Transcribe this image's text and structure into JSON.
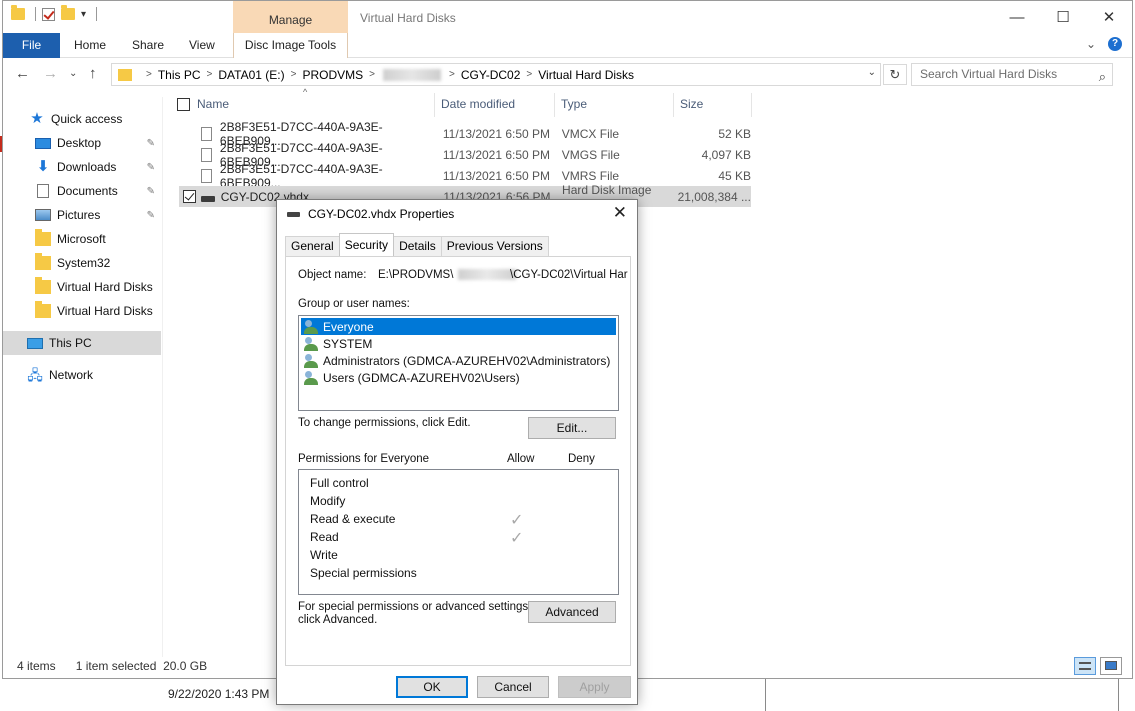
{
  "titlebar": {
    "manage_label": "Manage",
    "title": "Virtual Hard Disks",
    "minimize_glyph": "—",
    "maximize_glyph": "☐",
    "close_glyph": "✕",
    "qat_dropdown_glyph": "▾"
  },
  "ribbon": {
    "tabs": [
      {
        "label": "File"
      },
      {
        "label": "Home"
      },
      {
        "label": "Share"
      },
      {
        "label": "View"
      },
      {
        "label": "Disc Image Tools"
      }
    ],
    "collapse_glyph": "⌄",
    "help_glyph": "?"
  },
  "nav": {
    "back_glyph": "←",
    "forward_glyph": "→",
    "recent_glyph": "⌄",
    "up_glyph": "↑",
    "refresh_glyph": "↻",
    "search_placeholder": "Search Virtual Hard Disks",
    "search_glyph": "⌕",
    "dropdown_glyph": "⌄",
    "breadcrumb": {
      "sep": ">",
      "this_pc": "This PC",
      "drive": "DATA01 (E:)",
      "folder1": "PRODVMS",
      "folder3": "CGY-DC02",
      "folder4": "Virtual Hard Disks"
    }
  },
  "sidebar": {
    "pin_glyph": "📌",
    "items": [
      {
        "label": "Quick access",
        "icon": "star-icon"
      },
      {
        "label": "Desktop",
        "icon": "desktop-icon"
      },
      {
        "label": "Downloads",
        "icon": "download-icon"
      },
      {
        "label": "Documents",
        "icon": "document-icon"
      },
      {
        "label": "Pictures",
        "icon": "pictures-icon"
      },
      {
        "label": "Microsoft",
        "icon": "folder-icon"
      },
      {
        "label": "System32",
        "icon": "folder-icon"
      },
      {
        "label": "Virtual Hard Disks",
        "icon": "folder-icon"
      },
      {
        "label": "Virtual Hard Disks",
        "icon": "folder-icon"
      },
      {
        "label": "This PC",
        "icon": "computer-icon"
      },
      {
        "label": "Network",
        "icon": "network-icon"
      }
    ],
    "star_glyph": "★",
    "download_glyph": "⬇",
    "network_glyph": "🖧"
  },
  "filelist": {
    "columns": [
      "Name",
      "Date modified",
      "Type",
      "Size"
    ],
    "sort_glyph": "^",
    "rows": [
      {
        "name": "2B8F3E51-D7CC-440A-9A3E-6BEB909...",
        "date": "11/13/2021 6:50 PM",
        "type": "VMCX File",
        "size": "52 KB"
      },
      {
        "name": "2B8F3E51-D7CC-440A-9A3E-6BEB909...",
        "date": "11/13/2021 6:50 PM",
        "type": "VMGS File",
        "size": "4,097 KB"
      },
      {
        "name": "2B8F3E51-D7CC-440A-9A3E-6BEB909...",
        "date": "11/13/2021 6:50 PM",
        "type": "VMRS File",
        "size": "45 KB"
      },
      {
        "name": "CGY-DC02.vhdx",
        "date": "11/13/2021 6:56 PM",
        "type": "Hard Disk Image F...",
        "size": "21,008,384 ..."
      }
    ]
  },
  "status": {
    "count": "4 items",
    "selected": "1 item selected",
    "size": "20.0 GB"
  },
  "background": {
    "line1": "9/22/2020 1:43 PM"
  },
  "dialog": {
    "title": "CGY-DC02.vhdx Properties",
    "close_glyph": "✕",
    "tabs": [
      "General",
      "Security",
      "Details",
      "Previous Versions"
    ],
    "object_name_label": "Object name:",
    "object_name_prefix": "E:\\PRODVMS\\",
    "object_name_suffix": "\\CGY-DC02\\Virtual Har",
    "group_label": "Group or user names:",
    "users": [
      "Everyone",
      "SYSTEM",
      "Administrators (GDMCA-AZUREHV02\\Administrators)",
      "Users (GDMCA-AZUREHV02\\Users)"
    ],
    "change_text": "To change permissions, click Edit.",
    "edit_button": "Edit...",
    "perm_label": "Permissions for Everyone",
    "allow_label": "Allow",
    "deny_label": "Deny",
    "check_glyph": "✓",
    "permissions": [
      {
        "name": "Full control",
        "allow": false
      },
      {
        "name": "Modify",
        "allow": false
      },
      {
        "name": "Read & execute",
        "allow": true
      },
      {
        "name": "Read",
        "allow": true
      },
      {
        "name": "Write",
        "allow": false
      },
      {
        "name": "Special permissions",
        "allow": false
      }
    ],
    "special_text_1": "For special permissions or advanced settings,",
    "special_text_2": "click Advanced.",
    "advanced_button": "Advanced",
    "ok_button": "OK",
    "cancel_button": "Cancel",
    "apply_button": "Apply"
  },
  "colors": {
    "file_tab": "#1d5fae",
    "manage_tab": "#f9d9b6",
    "selection": "#0078d7"
  }
}
